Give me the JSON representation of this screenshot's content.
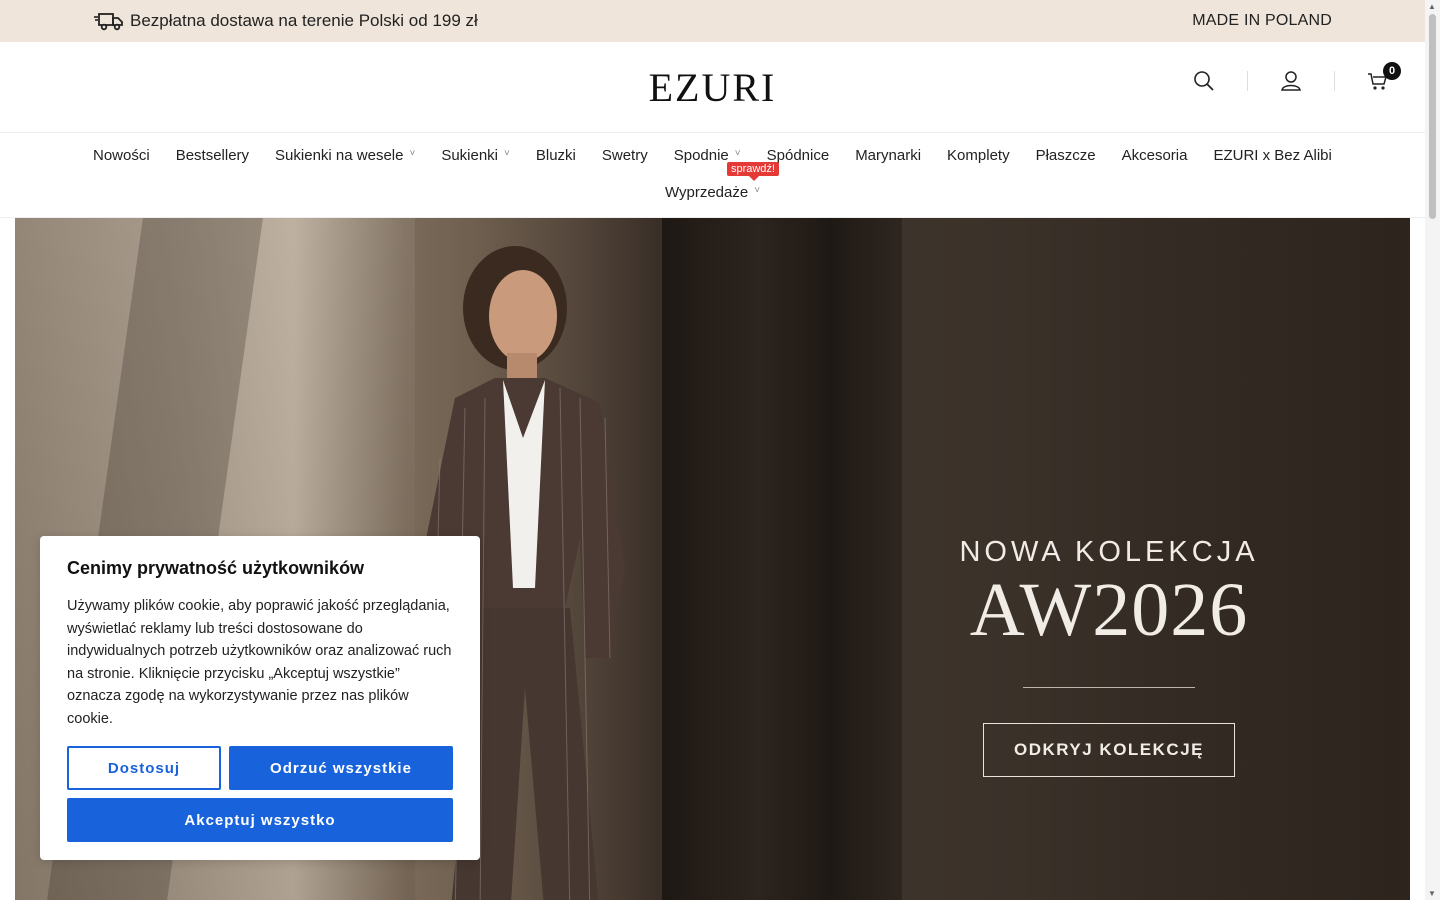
{
  "topbar": {
    "shipping_text": "Bezpłatna dostawa na terenie Polski od 199 zł",
    "made_in": "MADE IN POLAND"
  },
  "header": {
    "logo": "EZURI",
    "cart_count": "0"
  },
  "nav": {
    "items": [
      {
        "label": "Nowości"
      },
      {
        "label": "Bestsellery"
      },
      {
        "label": "Sukienki na wesele"
      },
      {
        "label": "Sukienki"
      },
      {
        "label": "Bluzki"
      },
      {
        "label": "Swetry"
      },
      {
        "label": "Spodnie"
      },
      {
        "label": "Spódnice"
      },
      {
        "label": "Marynarki"
      },
      {
        "label": "Komplety"
      },
      {
        "label": "Płaszcze"
      },
      {
        "label": "Akcesoria"
      },
      {
        "label": "EZURI x Bez Alibi"
      }
    ],
    "sale_label": "Wyprzedaże",
    "sale_badge": "sprawdź!"
  },
  "hero": {
    "subtitle": "NOWA KOLEKCJA",
    "title": "AW2026",
    "cta": "ODKRYJ KOLEKCJĘ"
  },
  "cookie": {
    "title": "Cenimy prywatność użytkowników",
    "body": "Używamy plików cookie, aby poprawić jakość przeglądania, wyświetlać reklamy lub treści dostosowane do indywidualnych potrzeb użytkowników oraz analizować ruch na stronie. Kliknięcie przycisku „Akceptuj wszystkie” oznacza zgodę na wykorzystywanie przez nas plików cookie.",
    "customize": "Dostosuj",
    "reject": "Odrzuć wszystkie",
    "accept": "Akceptuj wszystko"
  },
  "colors": {
    "topbar_bg": "#efe5da",
    "cookie_blue": "#1863dc",
    "badge_red": "#e53935"
  }
}
